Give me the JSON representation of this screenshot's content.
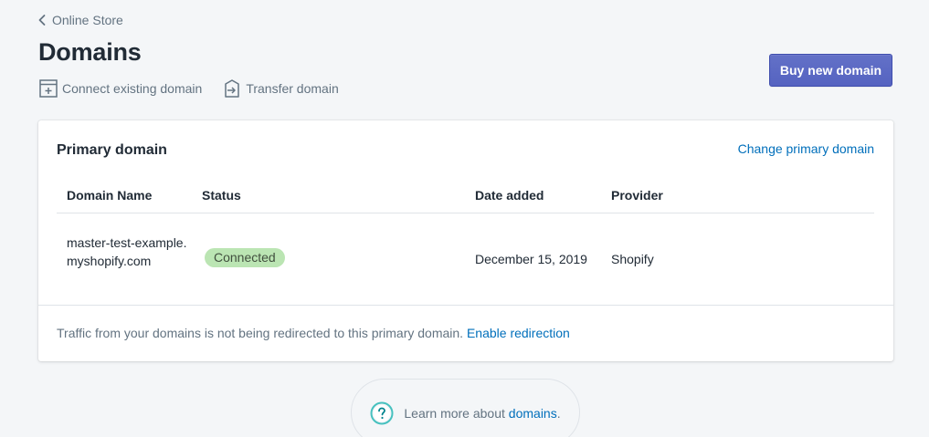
{
  "breadcrumb": {
    "label": "Online Store"
  },
  "page": {
    "title": "Domains"
  },
  "secondary_actions": {
    "connect": "Connect existing domain",
    "transfer": "Transfer domain"
  },
  "primary_action": {
    "label": "Buy new domain"
  },
  "primary_domain_card": {
    "title": "Primary domain",
    "action": "Change primary domain",
    "columns": [
      "Domain Name",
      "Status",
      "Date added",
      "Provider"
    ],
    "rows": [
      {
        "domain": "master-test-example.myshopify.com",
        "status": "Connected",
        "date_added": "December 15, 2019",
        "provider": "Shopify"
      }
    ],
    "footer": {
      "text": "Traffic from your domains is not being redirected to this primary domain.",
      "link": "Enable redirection"
    }
  },
  "help": {
    "text": "Learn more about",
    "link": "domains",
    "suffix": "."
  },
  "colors": {
    "accent": "#5c6ac4",
    "link": "#006fbb",
    "success_badge": "#bbe5b3",
    "help_icon": "#47c1bf"
  },
  "icons": {
    "back": "chevron-left-icon",
    "connect": "connect-domain-icon",
    "transfer": "transfer-domain-icon",
    "help": "question-circle-icon"
  }
}
